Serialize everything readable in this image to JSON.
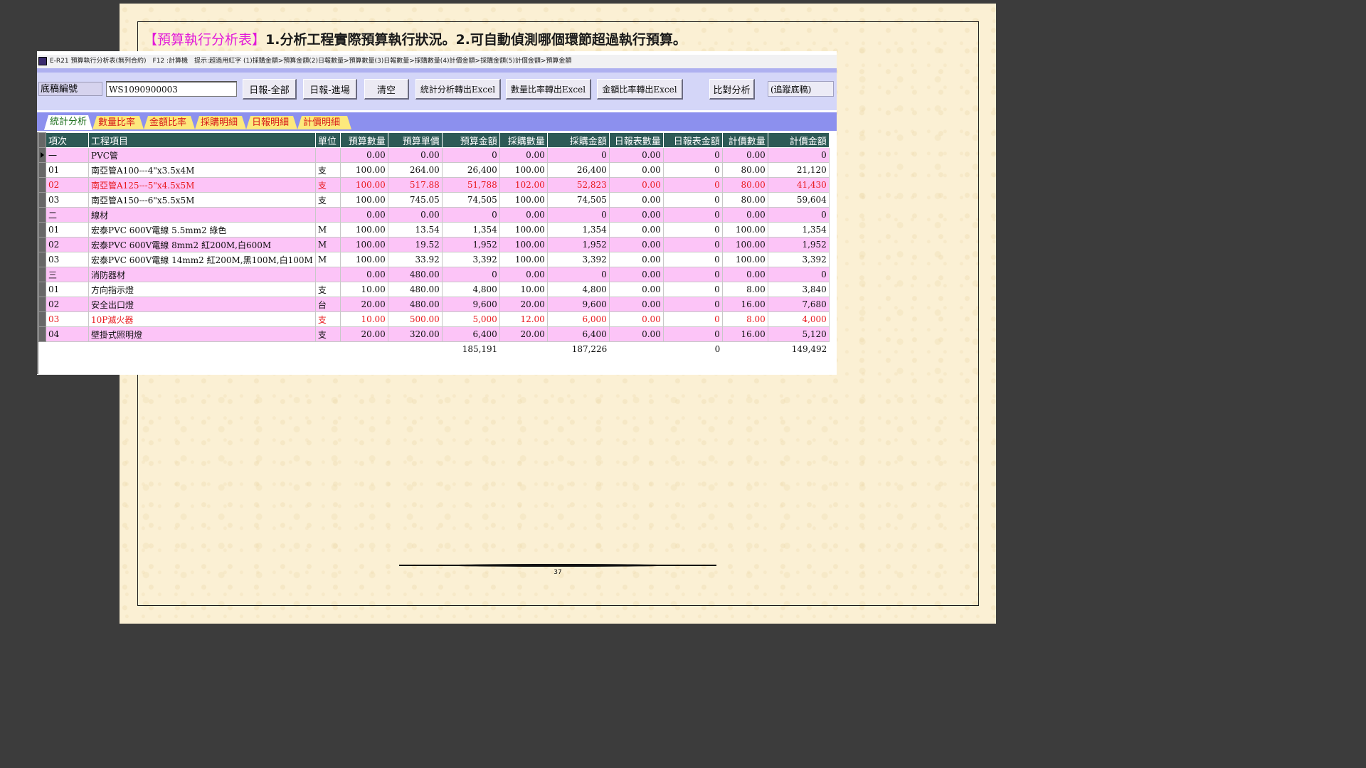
{
  "heading": {
    "bracket_title": "【預算執行分析表】",
    "description": "1.分析工程實際預算執行狀況。2.可自動偵測哪個環節超過執行預算。"
  },
  "window": {
    "title": "E-R21 預算執行分析表(無列合約)　F12 :計算機　提示:超過用紅字 (1)採購金額>預算金額(2)日報數量>預算數量(3)日報數量>採購數量(4)計價金額>採購金額(5)計價金額>預算金額"
  },
  "toolbar": {
    "draft_label": "底稿編號",
    "draft_value": "WS1090900003",
    "btn_daily_all": "日報-全部",
    "btn_daily_entry": "日報-進場",
    "btn_clear": "清空",
    "btn_export_stats": "統計分析轉出Excel",
    "btn_export_qty": "數量比率轉出Excel",
    "btn_export_amount": "金額比率轉出Excel",
    "btn_compare": "比對分析",
    "trace_label": "(追蹤底稿)"
  },
  "tabs": [
    "統計分析",
    "數量比率",
    "金額比率",
    "採購明細",
    "日報明細",
    "計價明細"
  ],
  "colors": {
    "header_bg": "#2d5a56",
    "pink_row": "#fcc4f7",
    "over_budget_text": "#e8191e",
    "tabbar": "#8c90ee",
    "tab_bg": "#fde97c",
    "heading_highlight": "#e21ad8"
  },
  "grid": {
    "columns": [
      "項次",
      "工程項目",
      "單位",
      "預算數量",
      "預算單價",
      "預算金額",
      "採購數量",
      "採購金額",
      "日報表數量",
      "日報表金額",
      "計價數量",
      "計價金額"
    ],
    "rows": [
      {
        "style": "pink",
        "over": false,
        "selected": true,
        "cells": [
          "一",
          "PVC管",
          "",
          "0.00",
          "0.00",
          "0",
          "0.00",
          "0",
          "0.00",
          "0",
          "0.00",
          "0"
        ]
      },
      {
        "style": "white",
        "over": false,
        "cells": [
          "01",
          "南亞管A100---4\"x3.5x4M",
          "支",
          "100.00",
          "264.00",
          "26,400",
          "100.00",
          "26,400",
          "0.00",
          "0",
          "80.00",
          "21,120"
        ]
      },
      {
        "style": "pink",
        "over": true,
        "cells": [
          "02",
          "南亞管A125---5\"x4.5x5M",
          "支",
          "100.00",
          "517.88",
          "51,788",
          "102.00",
          "52,823",
          "0.00",
          "0",
          "80.00",
          "41,430"
        ]
      },
      {
        "style": "white",
        "over": false,
        "cells": [
          "03",
          "南亞管A150---6\"x5.5x5M",
          "支",
          "100.00",
          "745.05",
          "74,505",
          "100.00",
          "74,505",
          "0.00",
          "0",
          "80.00",
          "59,604"
        ]
      },
      {
        "style": "pink",
        "over": false,
        "cells": [
          "二",
          "線材",
          "",
          "0.00",
          "0.00",
          "0",
          "0.00",
          "0",
          "0.00",
          "0",
          "0.00",
          "0"
        ]
      },
      {
        "style": "white",
        "over": false,
        "cells": [
          "01",
          "宏泰PVC 600V電線 5.5mm2 綠色",
          "M",
          "100.00",
          "13.54",
          "1,354",
          "100.00",
          "1,354",
          "0.00",
          "0",
          "100.00",
          "1,354"
        ]
      },
      {
        "style": "pink",
        "over": false,
        "cells": [
          "02",
          "宏泰PVC 600V電線 8mm2 紅200M,白600M",
          "M",
          "100.00",
          "19.52",
          "1,952",
          "100.00",
          "1,952",
          "0.00",
          "0",
          "100.00",
          "1,952"
        ]
      },
      {
        "style": "white",
        "over": false,
        "cells": [
          "03",
          "宏泰PVC 600V電線 14mm2 紅200M,黑100M,白100M",
          "M",
          "100.00",
          "33.92",
          "3,392",
          "100.00",
          "3,392",
          "0.00",
          "0",
          "100.00",
          "3,392"
        ]
      },
      {
        "style": "pink",
        "over": false,
        "cells": [
          "三",
          "消防器材",
          "",
          "0.00",
          "480.00",
          "0",
          "0.00",
          "0",
          "0.00",
          "0",
          "0.00",
          "0"
        ]
      },
      {
        "style": "white",
        "over": false,
        "cells": [
          "01",
          "方向指示燈",
          "支",
          "10.00",
          "480.00",
          "4,800",
          "10.00",
          "4,800",
          "0.00",
          "0",
          "8.00",
          "3,840"
        ]
      },
      {
        "style": "pink",
        "over": false,
        "cells": [
          "02",
          "安全出口燈",
          "台",
          "20.00",
          "480.00",
          "9,600",
          "20.00",
          "9,600",
          "0.00",
          "0",
          "16.00",
          "7,680"
        ]
      },
      {
        "style": "white",
        "over": true,
        "cells": [
          "03",
          "10P滅火器",
          "支",
          "10.00",
          "500.00",
          "5,000",
          "12.00",
          "6,000",
          "0.00",
          "0",
          "8.00",
          "4,000"
        ]
      },
      {
        "style": "pink",
        "over": false,
        "cells": [
          "04",
          "壁掛式照明燈",
          "支",
          "20.00",
          "320.00",
          "6,400",
          "20.00",
          "6,400",
          "0.00",
          "0",
          "16.00",
          "5,120"
        ]
      }
    ],
    "totals": [
      "",
      "",
      "",
      "",
      "",
      "185,191",
      "",
      "187,226",
      "",
      "0",
      "",
      "149,492"
    ]
  },
  "footer": {
    "page_number": "37"
  }
}
